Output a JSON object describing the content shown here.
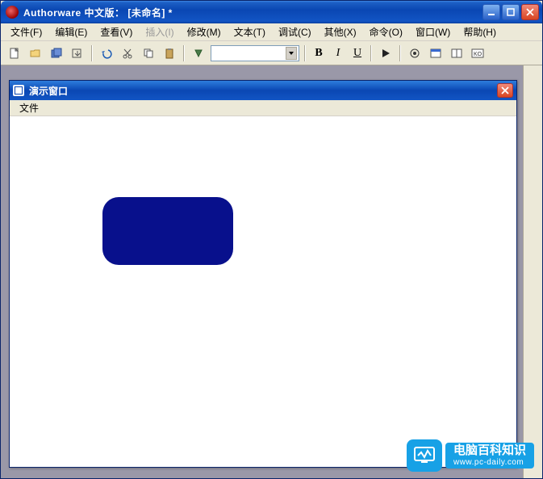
{
  "window": {
    "title": "Authorware 中文版： [未命名]  *"
  },
  "menu": {
    "file": "文件(F)",
    "edit": "编辑(E)",
    "view": "查看(V)",
    "insert": "插入(I)",
    "modify": "修改(M)",
    "text": "文本(T)",
    "debug": "调试(C)",
    "other": "其他(X)",
    "command": "命令(O)",
    "window": "窗口(W)",
    "help": "帮助(H)"
  },
  "toolbar": {
    "bold": "B",
    "italic": "I",
    "underline": "U"
  },
  "demo_window": {
    "title": "演示窗口",
    "menu_file": "文件"
  },
  "colors": {
    "shape_fill": "#08108c",
    "titlebar_start": "#3b84e0",
    "titlebar_end": "#0a47b3"
  },
  "watermark": {
    "line1": "电脑百科知识",
    "line2": "www.pc-daily.com"
  }
}
